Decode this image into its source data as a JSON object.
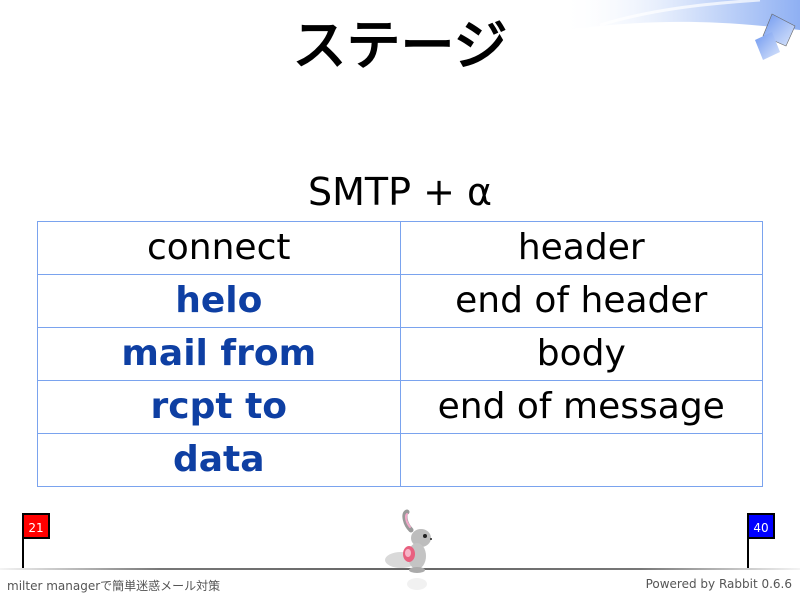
{
  "slide": {
    "title": "ステージ",
    "subtitle": "SMTP + α"
  },
  "table": {
    "rows": [
      {
        "left": "connect",
        "left_highlight": false,
        "right": "header"
      },
      {
        "left": "helo",
        "left_highlight": true,
        "right": "end of header"
      },
      {
        "left": "mail from",
        "left_highlight": true,
        "right": "body"
      },
      {
        "left": "rcpt to",
        "left_highlight": true,
        "right": "end of message"
      },
      {
        "left": "data",
        "left_highlight": true,
        "right": ""
      }
    ]
  },
  "progress": {
    "current_page": "21",
    "total_pages": "40",
    "current_flag_color": "#ff0000",
    "total_flag_color": "#0000ff"
  },
  "footer": {
    "presentation_title": "milter managerで簡単迷惑メール対策",
    "powered_by": "Powered by Rabbit 0.6.6"
  },
  "colors": {
    "highlight_text": "#0e3fa3",
    "table_border": "#7aa3ee"
  }
}
